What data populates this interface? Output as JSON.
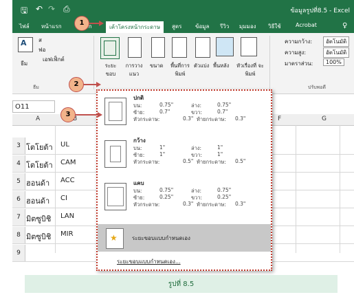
{
  "title_bar": {
    "title": "ข้อมูลรูปที่8.5 - Excel"
  },
  "tabs": [
    {
      "label": "ไฟล์"
    },
    {
      "label": "หน้าแรก"
    },
    {
      "label": "แทรก"
    },
    {
      "label": "เค้าโครงหน้ากระดาษ"
    },
    {
      "label": "สูตร"
    },
    {
      "label": "ข้อมูล"
    },
    {
      "label": "รีวิว"
    },
    {
      "label": "มุมมอง"
    },
    {
      "label": "วิธีใช้"
    },
    {
      "label": "Acrobat"
    }
  ],
  "ribbon": {
    "theme_label": "ธีม",
    "theme_small": [
      "ส",
      "ฟอ",
      "เอฟเฟ็กต์"
    ],
    "theme_group": "ธีม",
    "margins": "ระยะขอบ",
    "orientation": "การวาง แนว",
    "size": "ขนาด",
    "print_area": "พื้นที่การ พิมพ์",
    "breaks": "ตัวแบ่ง",
    "background": "พื้นหลัง",
    "print_titles": "หัวเรื่องที่ จะพิมพ์",
    "width_label": "ความกว้าง:",
    "width_value": "อัตโนมัติ",
    "height_label": "ความสูง:",
    "height_value": "อัตโนมัติ",
    "scale_label": "มาตราส่วน:",
    "scale_value": "100%",
    "scale_group": "ปรับพอดี"
  },
  "badges": [
    "1",
    "2",
    "3"
  ],
  "name_box": "O11",
  "columns": [
    "A",
    "B",
    "F",
    "G"
  ],
  "rows": [
    {
      "num": "3",
      "a": "โตโยต้า",
      "b": "UL"
    },
    {
      "num": "4",
      "a": "โตโยต้า",
      "b": "CAM"
    },
    {
      "num": "5",
      "a": "ฮอนด้า",
      "b": "ACC"
    },
    {
      "num": "6",
      "a": "ฮอนด้า",
      "b": "CI"
    },
    {
      "num": "7",
      "a": "มิตซูบิชิ",
      "b": "LAN"
    },
    {
      "num": "8",
      "a": "มิตซูบิชิ",
      "b": "MIR"
    },
    {
      "num": "9",
      "a": "",
      "b": ""
    }
  ],
  "margins_menu": {
    "options": [
      {
        "title": "ปกติ",
        "top_l": "บน:",
        "top_v": "0.75\"",
        "bottom_l": "ล่าง:",
        "bottom_v": "0.75\"",
        "left_l": "ซ้าย:",
        "left_v": "0.7\"",
        "right_l": "ขวา:",
        "right_v": "0.7\"",
        "header_l": "หัวกระดาษ:",
        "header_v": "0.3\"",
        "footer_l": "ท้ายกระดาษ:",
        "footer_v": "0.3\""
      },
      {
        "title": "กว้าง",
        "top_l": "บน:",
        "top_v": "1\"",
        "bottom_l": "ล่าง:",
        "bottom_v": "1\"",
        "left_l": "ซ้าย:",
        "left_v": "1\"",
        "right_l": "ขวา:",
        "right_v": "1\"",
        "header_l": "หัวกระดาษ:",
        "header_v": "0.5\"",
        "footer_l": "ท้ายกระดาษ:",
        "footer_v": "0.5\""
      },
      {
        "title": "แคบ",
        "top_l": "บน:",
        "top_v": "0.75\"",
        "bottom_l": "ล่าง:",
        "bottom_v": "0.75\"",
        "left_l": "ซ้าย:",
        "left_v": "0.25\"",
        "right_l": "ขวา:",
        "right_v": "0.25\"",
        "header_l": "หัวกระดาษ:",
        "header_v": "0.3\"",
        "footer_l": "ท้ายกระดาษ:",
        "footer_v": "0.3\""
      }
    ],
    "custom_last": "ระยะขอบแบบกำหนดเอง",
    "custom_link": "ระยะขอบแบบกำหนดเอง..."
  },
  "caption": "รูปที่ 8.5",
  "colors": {
    "excel_green": "#217346",
    "badge": "#f2b38a",
    "annotation_red": "#c0504d",
    "caption_bg": "#dff0e6"
  }
}
